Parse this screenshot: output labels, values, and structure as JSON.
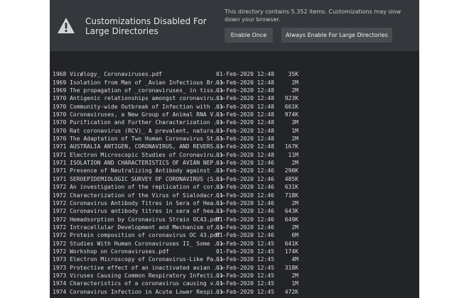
{
  "banner": {
    "icon": "warning-icon",
    "title": "Customizations Disabled For Large Directories",
    "message": "This directory contains 5.352 items. Customizations may slow down your browser.",
    "enable_once_label": "Enable Once",
    "always_enable_label": "Always Enable For Large Directories"
  },
  "listing": {
    "parent_link": "../",
    "rows": [
      {
        "name": "1968 Virology_ Coronaviruses.pdf",
        "date": "01-Feb-2020 12:48",
        "size": "35K"
      },
      {
        "name": "1969 Isolation from Man of _Avian Infectious Br..>",
        "date": "01-Feb-2020 12:48",
        "size": "2M"
      },
      {
        "name": "1969 The propagation of _coronaviruses_ in tiss..>",
        "date": "01-Feb-2020 12:48",
        "size": "2M"
      },
      {
        "name": "1970 Antigenic relationships amongst coronaviru..>",
        "date": "01-Feb-2020 12:48",
        "size": "923K"
      },
      {
        "name": "1970 Community-wide Outbreak of Infection with ..>",
        "date": "01-Feb-2020 12:48",
        "size": "661K"
      },
      {
        "name": "1970 Coronaviruses, a New Group of Animal RNA V..>",
        "date": "01-Feb-2020 12:48",
        "size": "974K"
      },
      {
        "name": "1970 Purification and Further Characterization ..>",
        "date": "01-Feb-2020 12:48",
        "size": "3M"
      },
      {
        "name": "1970 Rat coronavirus (RCV)_ A prevalent, natura..>",
        "date": "01-Feb-2020 12:48",
        "size": "1M"
      },
      {
        "name": "1970 The Adaptation of Two Human Coronavirus St..>",
        "date": "01-Feb-2020 12:48",
        "size": "2M"
      },
      {
        "name": "1971 AUSTRALIA ANTIGEN, CORONAVIRUS, AND REVERS..>",
        "date": "01-Feb-2020 12:48",
        "size": "167K"
      },
      {
        "name": "1971 Electron Microscopic Studies of Coronaviru..>",
        "date": "01-Feb-2020 12:48",
        "size": "11M"
      },
      {
        "name": "1971 ISOLATION AND CHARACTERISTICS OF AVIAN NEP..>",
        "date": "01-Feb-2020 12:46",
        "size": "2M"
      },
      {
        "name": "1971 Presence of Neutralizing Antibody against ..>",
        "date": "01-Feb-2020 12:46",
        "size": "290K"
      },
      {
        "name": "1971 SEROEPIDEMIOLOGIC SURVEY OF CORONAVIRUS (S..>",
        "date": "01-Feb-2020 12:46",
        "size": "485K"
      },
      {
        "name": "1972 An investigation of the replication of cor..>",
        "date": "01-Feb-2020 12:46",
        "size": "631K"
      },
      {
        "name": "1972 Characterization of the Virus of Sialodacr..>",
        "date": "01-Feb-2020 12:46",
        "size": "718K"
      },
      {
        "name": "1972 Coronavirus Antibody Titres in Sera of Hea..>",
        "date": "01-Feb-2020 12:46",
        "size": "2M"
      },
      {
        "name": "1972 Coronavirus antibody titres in sera of hea..>",
        "date": "01-Feb-2020 12:46",
        "size": "643K"
      },
      {
        "name": "1972 Hemadsorption by Coronavirus Strain OC43.pdf",
        "date": "01-Feb-2020 12:46",
        "size": "649K"
      },
      {
        "name": "1972 Intracellular Development and Mechanism of..>",
        "date": "01-Feb-2020 12:46",
        "size": "2M"
      },
      {
        "name": "1972 Protein composition of coronavirus OC 43.pdf",
        "date": "01-Feb-2020 12:46",
        "size": "6M"
      },
      {
        "name": "1972 Studies With Human Coronaviruses II_ Some ..>",
        "date": "01-Feb-2020 12:45",
        "size": "641K"
      },
      {
        "name": "1972 Workshop on Coronaviruses.pdf",
        "date": "01-Feb-2020 12:45",
        "size": "174K"
      },
      {
        "name": "1973 Electron Microscopy of Coronavirus-Like Pa..>",
        "date": "01-Feb-2020 12:45",
        "size": "4M"
      },
      {
        "name": "1973 Protective effect of an inactivated avian ..>",
        "date": "01-Feb-2020 12:45",
        "size": "318K"
      },
      {
        "name": "1973 Viruses Causing Common Respiratory Infecti..>",
        "date": "01-Feb-2020 12:45",
        "size": "2M"
      },
      {
        "name": "1974 Characteristics of a coronavirus causing v..>",
        "date": "01-Feb-2020 12:45",
        "size": "1M"
      },
      {
        "name": "1974 Coronavirus Infection in Acute Lower Respi..>",
        "date": "01-Feb-2020 12:45",
        "size": "472K"
      }
    ]
  }
}
